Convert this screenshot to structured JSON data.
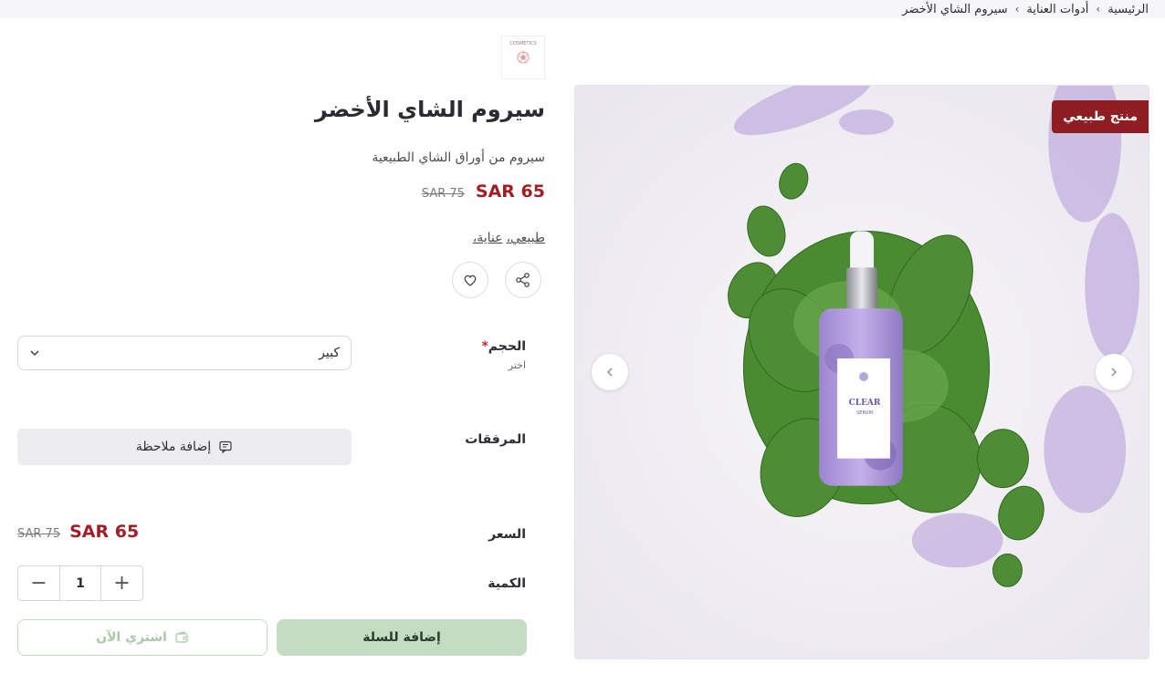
{
  "breadcrumb": {
    "home": "الرئيسية",
    "category": "أدوات العناية",
    "current": "سيروم الشاي الأخضر",
    "separator": "‹"
  },
  "store_logo": {
    "text": "COSMETICS"
  },
  "product": {
    "title": "سيروم الشاي الأخضر",
    "subtitle": "سيروم من أوراق الشاي الطبيعية",
    "price": "SAR 65",
    "old_price": "SAR 75",
    "tags": [
      "عناية،",
      "طبيعي،"
    ],
    "badge": "منتج طبيعي",
    "bottle_label": "CLEAR",
    "bottle_sublabel": "SERUM"
  },
  "options": {
    "size_label": "الحجم",
    "size_required": "*",
    "size_hint": "اختر",
    "size_value": "كبير"
  },
  "attachments": {
    "label": "المرفقات",
    "add_note": "إضافة ملاحظة"
  },
  "purchase": {
    "price_label": "السعر",
    "price": "SAR 65",
    "old_price": "SAR 75",
    "quantity_label": "الكمية",
    "quantity": "1",
    "minus": "−",
    "plus": "+",
    "add_to_cart": "إضافة للسلة",
    "buy_now": "اشتري الآن"
  },
  "colors": {
    "accent": "#a31d25",
    "badge": "#8e1d24",
    "cart_button": "#c3dcc2"
  },
  "icons": {
    "share": "share-icon",
    "favorite": "heart-icon",
    "note": "note-icon",
    "wallet": "wallet-icon",
    "chevron": "chevron-down-icon",
    "prev": "chevron-left-icon",
    "next": "chevron-right-icon"
  }
}
